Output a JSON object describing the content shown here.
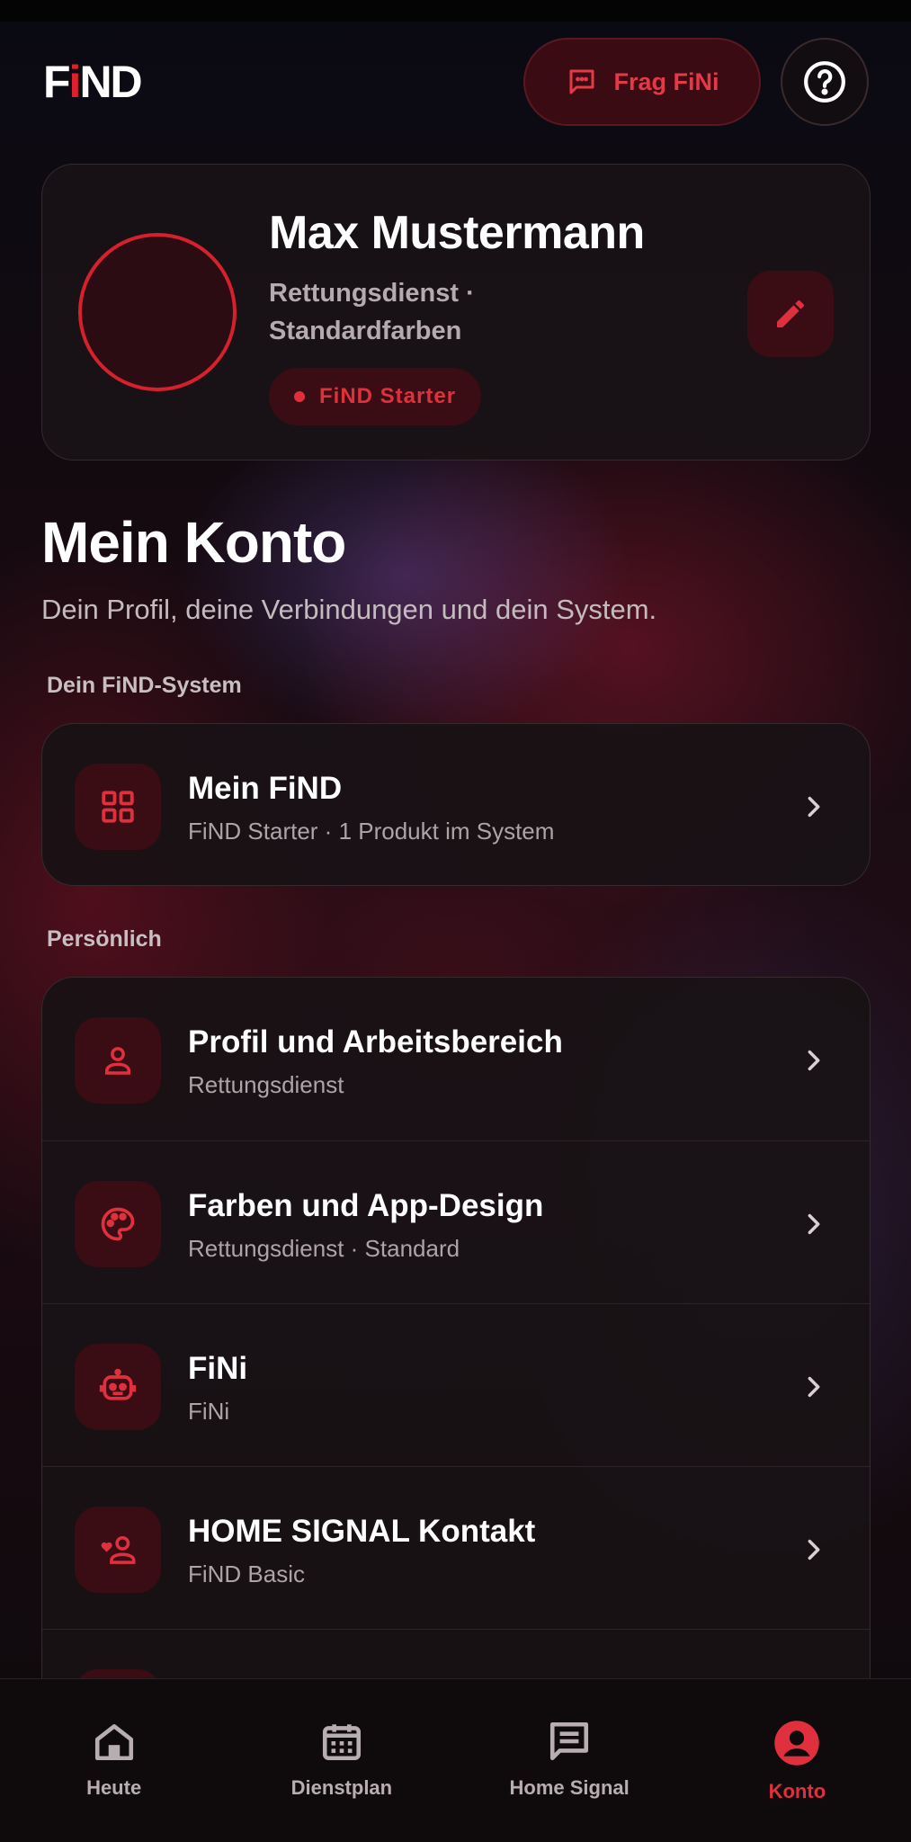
{
  "header": {
    "logo_text": "FiND",
    "ask_button_label": "Frag FiNi",
    "help_icon": "help-circle-icon"
  },
  "profile": {
    "name": "Max Mustermann",
    "subtitle_line1": "Rettungsdienst ·",
    "subtitle_line2": "Standardfarben",
    "badge_label": "FiND Starter",
    "edit_icon": "pencil-icon"
  },
  "page": {
    "title": "Mein Konto",
    "subtitle": "Dein Profil, deine Verbindungen und dein System."
  },
  "sections": {
    "system_label": "Dein FiND-System",
    "personal_label": "Persönlich"
  },
  "system_items": [
    {
      "icon": "grid-icon",
      "title": "Mein FiND",
      "subtitle": "FiND Starter · 1 Produkt im System"
    }
  ],
  "personal_items": [
    {
      "icon": "person-icon",
      "title": "Profil und Arbeitsbereich",
      "subtitle": "Rettungsdienst"
    },
    {
      "icon": "palette-icon",
      "title": "Farben und App-Design",
      "subtitle": "Rettungsdienst · Standard"
    },
    {
      "icon": "robot-icon",
      "title": "FiNi",
      "subtitle": "FiNi"
    },
    {
      "icon": "heart-person-icon",
      "title": "HOME SIGNAL Kontakt",
      "subtitle": "FiND Basic"
    }
  ],
  "bottom_nav": [
    {
      "icon": "home-icon",
      "label": "Heute",
      "active": false
    },
    {
      "icon": "calendar-icon",
      "label": "Dienstplan",
      "active": false
    },
    {
      "icon": "message-icon",
      "label": "Home Signal",
      "active": false
    },
    {
      "icon": "account-icon",
      "label": "Konto",
      "active": true
    }
  ],
  "colors": {
    "accent": "#e0303e",
    "accent_bg": "#3a0d14",
    "background": "#0c0a0c",
    "card": "#181215"
  }
}
